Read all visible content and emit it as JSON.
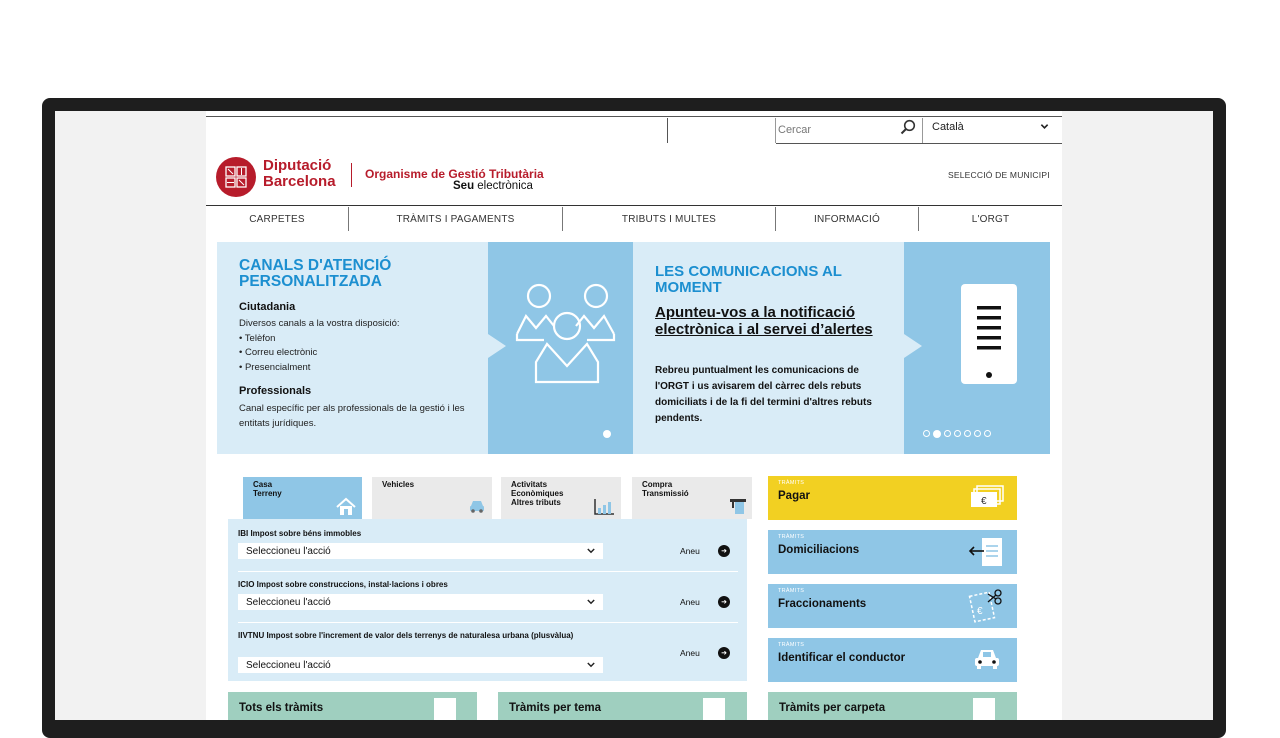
{
  "search": {
    "placeholder": "Cercar"
  },
  "language": {
    "selected": "Català"
  },
  "header": {
    "logo_line1": "Diputació",
    "logo_line2": "Barcelona",
    "org_title": "Organisme de Gestió Tributària",
    "seu_bold": "Seu",
    "seu_rest": " electrònica",
    "municipality_link": "SELECCIÓ DE MUNICIPI"
  },
  "nav": [
    "CARPETES",
    "TRÀMITS I PAGAMENTS",
    "TRIBUTS I MULTES",
    "INFORMACIÓ",
    "L'ORGT"
  ],
  "banner": {
    "left": {
      "title": "CANALS D'ATENCIÓ PERSONALITZADA",
      "ciutadania_heading": "Ciutadania",
      "ciutadania_text": "Diversos canals a la vostra disposició:",
      "channels": [
        "Telèfon",
        "Correu electrònic",
        "Presencialment"
      ],
      "professionals_heading": "Professionals",
      "professionals_text": "Canal específic per als professionals de la gestió i les entitats jurídiques."
    },
    "right": {
      "title": "LES COMUNICACIONS AL MOMENT",
      "link": "Apunteu-vos a la notificació electrònica i al servei d’alertes",
      "text": "Rebreu puntualment les comunicacions de l'ORGT i us avisarem del càrrec dels rebuts domiciliats i de la fi del termini d'altres rebuts pendents."
    },
    "carousel_dots": 7,
    "carousel_active": 1
  },
  "tabs": [
    {
      "label_line1": "Casa",
      "label_line2": "Terreny",
      "label_line3": "",
      "icon": "house-icon",
      "active": true
    },
    {
      "label_line1": "Vehicles",
      "label_line2": "",
      "label_line3": "",
      "icon": "car-icon",
      "active": false
    },
    {
      "label_line1": "Activitats",
      "label_line2": "Econòmiques",
      "label_line3": "Altres tributs",
      "icon": "bar-chart-icon",
      "active": false
    },
    {
      "label_line1": "Compra",
      "label_line2": "Transmissió",
      "label_line3": "",
      "icon": "key-tag-icon",
      "active": false
    }
  ],
  "taxes": [
    {
      "label": "IBI Impost sobre béns immobles",
      "select": "Seleccioneu l'acció",
      "go": "Aneu"
    },
    {
      "label": "ICIO Impost sobre construccions, instal·lacions i obres",
      "select": "Seleccioneu l'acció",
      "go": "Aneu"
    },
    {
      "label": "IIVTNU Impost sobre l'increment de valor dels terrenys de naturalesa urbana (plusvàlua)",
      "select": "Seleccioneu l'acció",
      "go": "Aneu"
    }
  ],
  "actions": [
    {
      "small": "TRÀMITS",
      "title": "Pagar",
      "color": "#f2d022",
      "icon": "euro-notes-icon"
    },
    {
      "small": "TRÀMITS",
      "title": "Domiciliacions",
      "color": "#8fc6e6",
      "icon": "document-arrow-icon"
    },
    {
      "small": "TRÀMITS",
      "title": "Fraccionaments",
      "color": "#8fc6e6",
      "icon": "scissors-document-icon"
    },
    {
      "small": "TRÀMITS",
      "title": "Identificar el conductor",
      "color": "#8fc6e6",
      "icon": "car-icon"
    }
  ],
  "bottom_cards": [
    {
      "title": "Tots els tràmits"
    },
    {
      "title": "Tràmits per tema"
    },
    {
      "title": "Tràmits per carpeta"
    }
  ]
}
